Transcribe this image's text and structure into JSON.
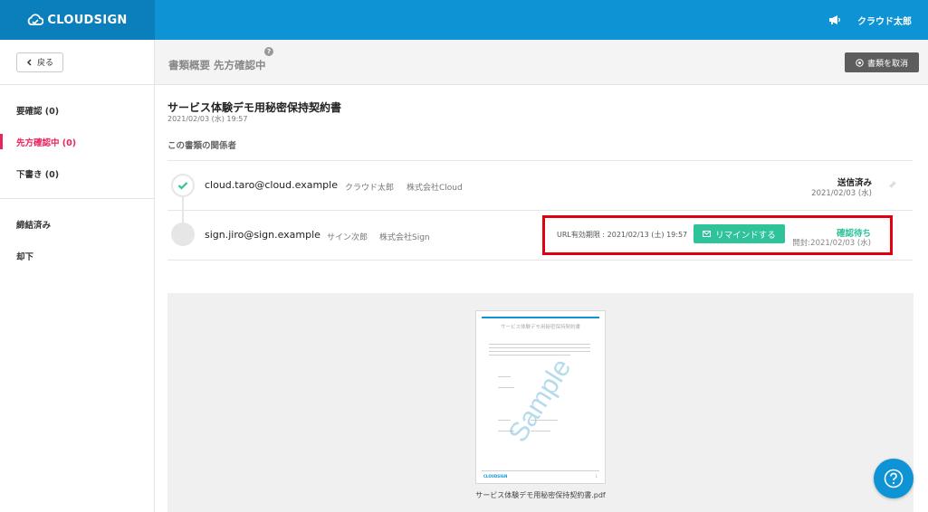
{
  "brand": {
    "name": "CLOUDSIGN"
  },
  "header": {
    "user_name": "クラウド太郎",
    "notice_icon": "megaphone-icon"
  },
  "sidebar": {
    "back_label": "戻る",
    "items": [
      {
        "label": "要確認 (0)"
      },
      {
        "label": "先方確認中 (0)",
        "active": true
      },
      {
        "label": "下書き (0)"
      },
      {
        "label": "締結済み"
      },
      {
        "label": "却下"
      }
    ]
  },
  "main": {
    "title": "書類概要 先方確認中",
    "help_label": "?",
    "cancel_label": "書類を取消"
  },
  "document": {
    "title": "サービス体験デモ用秘密保持契約書",
    "date": "2021/02/03 (水) 19:57",
    "section_label": "この書類の関係者",
    "participants": [
      {
        "email": "cloud.taro@cloud.example",
        "name": "クラウド太郎",
        "company": "株式会社Cloud",
        "status": "送信済み",
        "status_date": "2021/02/03 (水)"
      },
      {
        "email": "sign.jiro@sign.example",
        "name": "サイン次郎",
        "company": "株式会社Sign",
        "url_expiry": "URL有効期限 : 2021/02/13 (土) 19:57",
        "remind_label": "リマインドする",
        "status": "確認待ち",
        "status_date": "開封:2021/02/03 (水)"
      }
    ]
  },
  "preview": {
    "caption": "サービス体験デモ用秘密保持契約書.pdf",
    "paper_title": "サービス体験デモ用秘密保持契約書",
    "watermark": "Sample",
    "footer_brand": "CLOUDSIGN",
    "page_number": "1"
  },
  "colors": {
    "brand": "#0e93d5",
    "accent_pink": "#e8245a",
    "accent_green": "#2fc39a",
    "highlight": "#e00010"
  }
}
